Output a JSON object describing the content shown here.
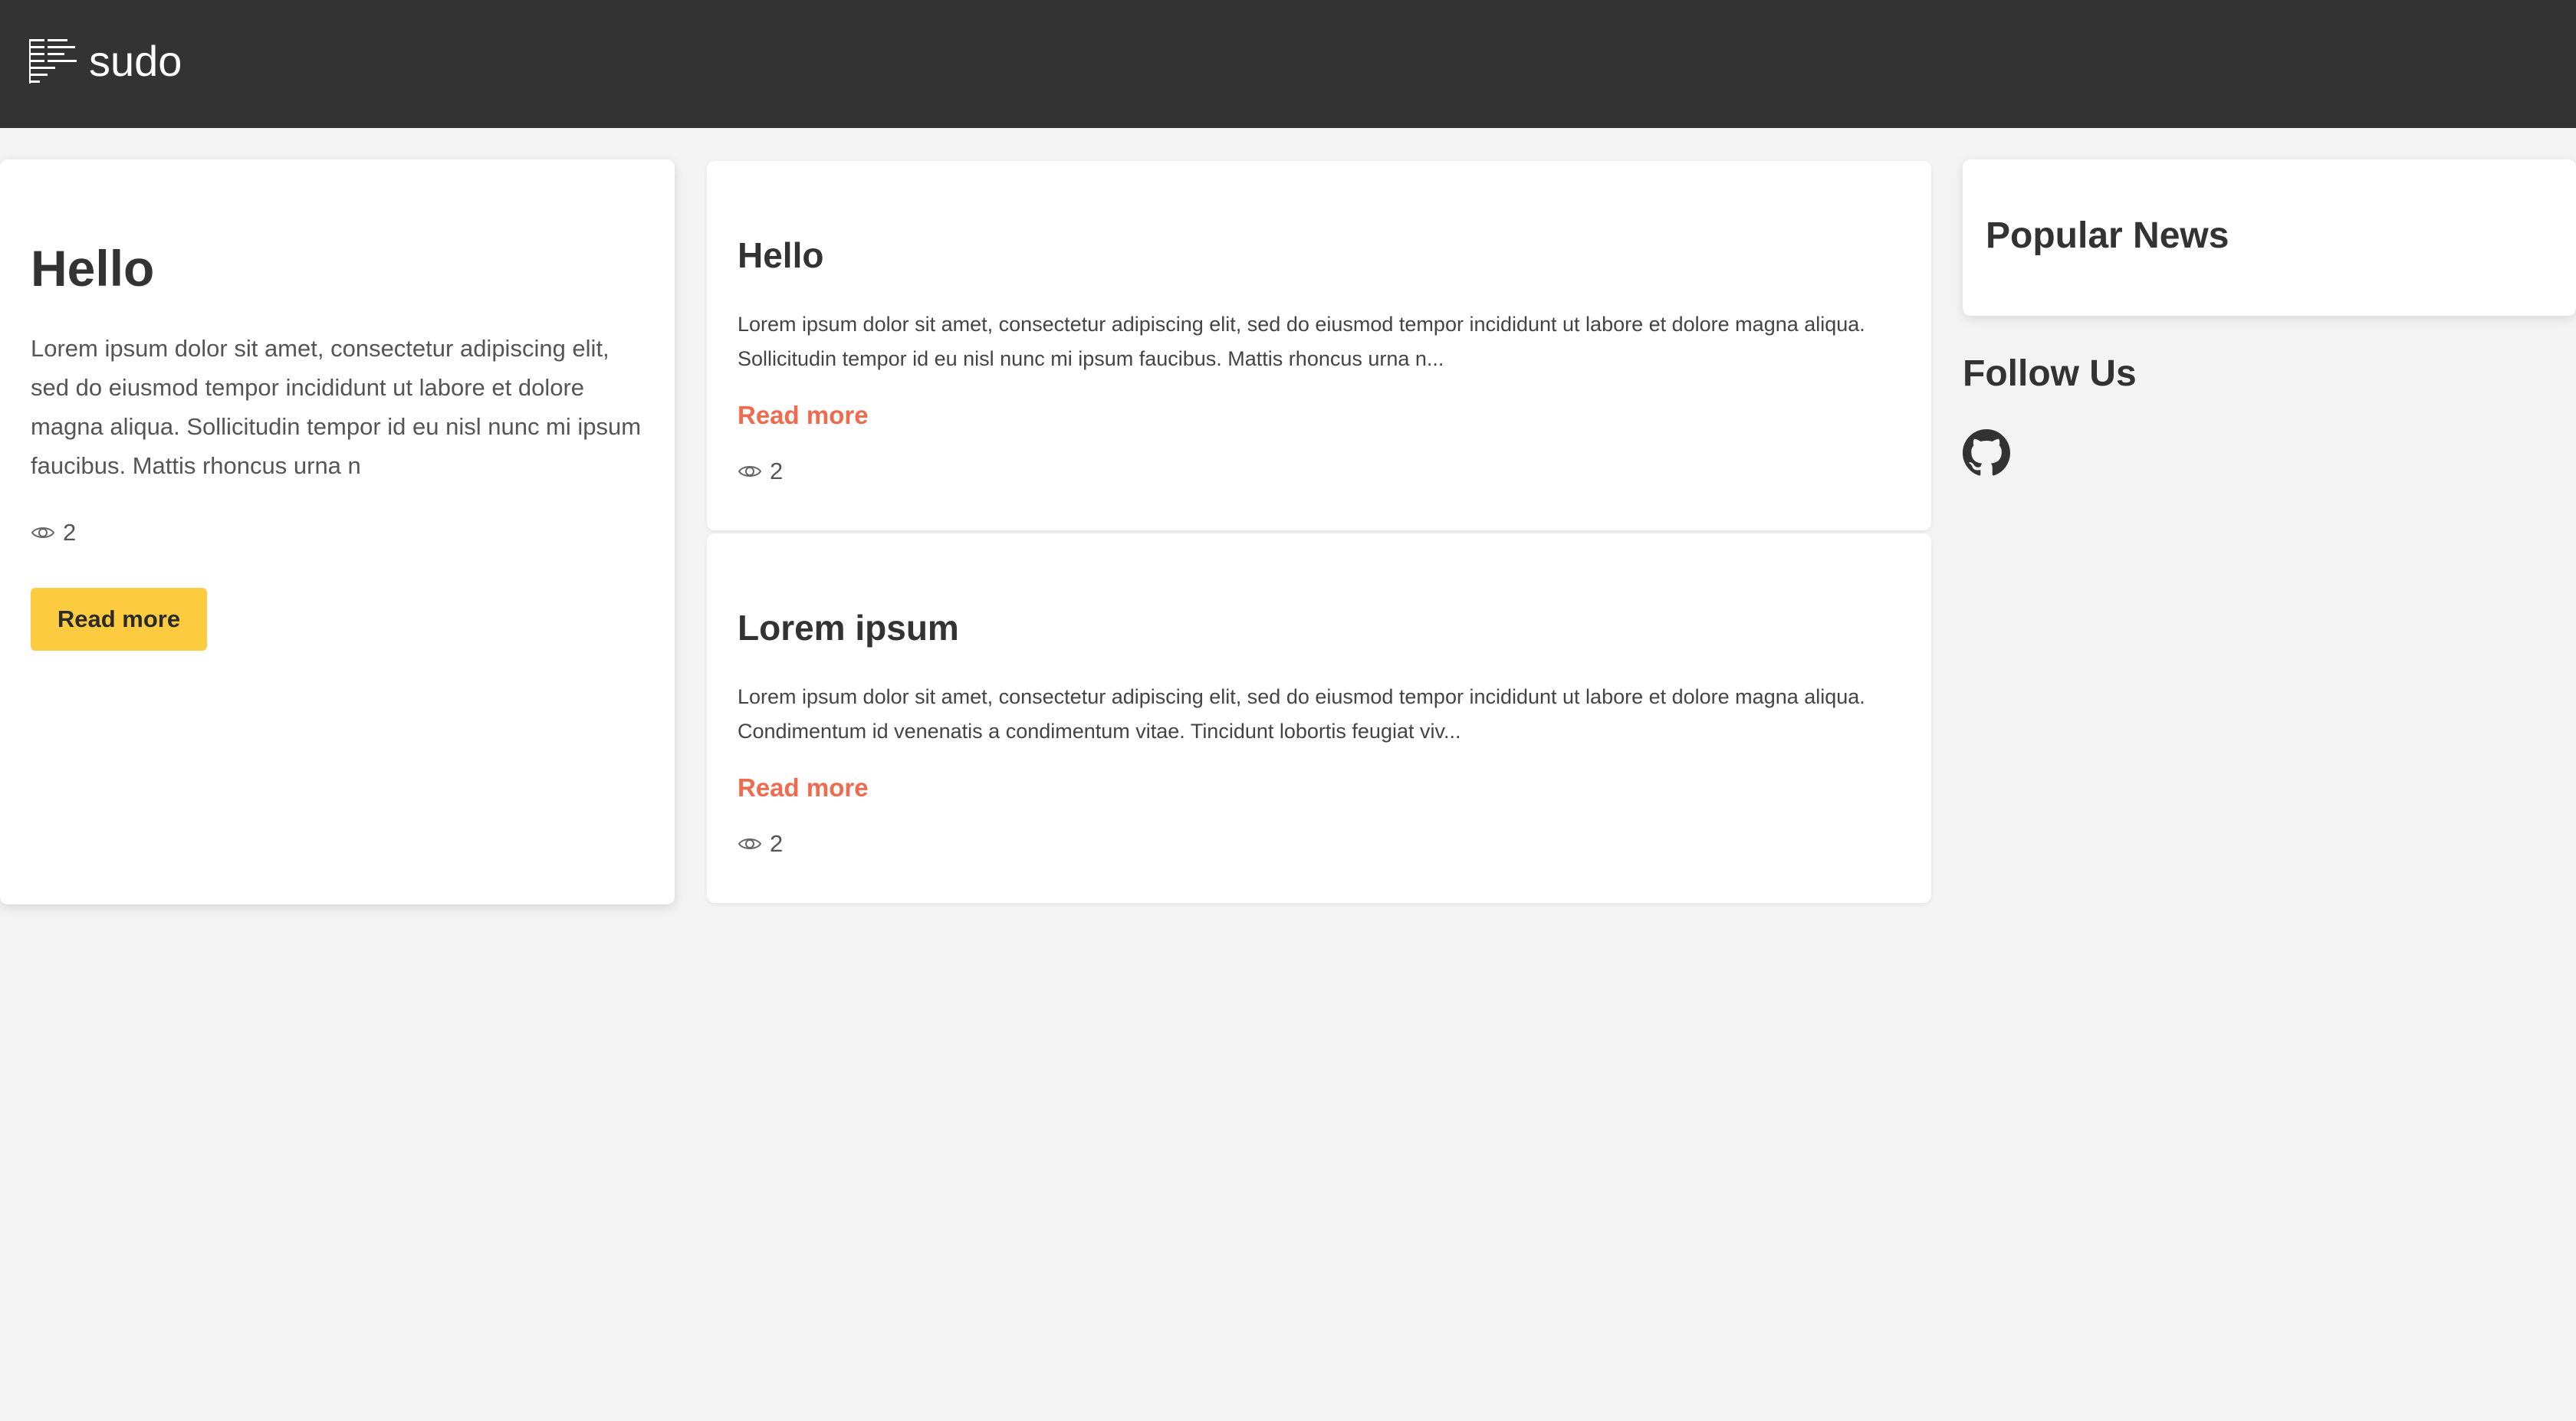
{
  "navbar": {
    "brand_name": "sudo",
    "logo_icon": "menu-lines-logo-icon"
  },
  "featured_post": {
    "title": "Hello",
    "excerpt": "Lorem ipsum dolor sit amet, consectetur adipiscing elit, sed do eiusmod tempor incididunt ut labore et dolore magna aliqua. Sollicitudin tempor id eu nisl nunc mi ipsum faucibus. Mattis rhoncus urna n",
    "views": "2",
    "read_more_label": "Read more"
  },
  "posts": [
    {
      "title": "Hello",
      "excerpt": "Lorem ipsum dolor sit amet, consectetur adipiscing elit, sed do eiusmod tempor incididunt ut labore et dolore magna aliqua. Sollicitudin tempor id eu nisl nunc mi ipsum faucibus. Mattis rhoncus urna n...",
      "read_more_label": "Read more",
      "views": "2"
    },
    {
      "title": "Lorem ipsum",
      "excerpt": "Lorem ipsum dolor sit amet, consectetur adipiscing elit, sed do eiusmod tempor incididunt ut labore et dolore magna aliqua. Condimentum id venenatis a condimentum vitae. Tincidunt lobortis feugiat viv...",
      "read_more_label": "Read more",
      "views": "2"
    }
  ],
  "sidebar": {
    "popular_news_title": "Popular News",
    "follow_us_title": "Follow Us",
    "social_icons": [
      "github-icon"
    ]
  },
  "colors": {
    "navbar_bg": "#333333",
    "page_bg": "#f3f3f3",
    "accent_yellow": "#fccb3f",
    "link_coral": "#ee6b4d"
  },
  "icons": {
    "views": "eye-icon"
  }
}
